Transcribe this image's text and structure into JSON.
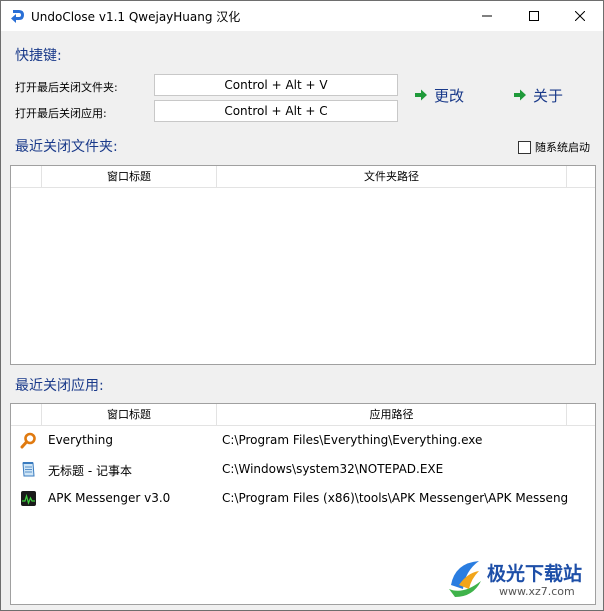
{
  "window": {
    "title": "UndoClose v1.1  QwejayHuang 汉化",
    "controls": {
      "minimize": "minimize",
      "maximize": "maximize",
      "close": "close"
    }
  },
  "hotkeys": {
    "section_title": "快捷键:",
    "folder_label": "打开最后关闭文件夹:",
    "folder_value": "Control + Alt + V",
    "app_label": "打开最后关闭应用:",
    "app_value": "Control + Alt + C",
    "change_label": "更改",
    "about_label": "关于"
  },
  "folders": {
    "section_title": "最近关闭文件夹:",
    "autostart_label": "随系统启动",
    "autostart_checked": false,
    "columns": [
      "窗口标题",
      "文件夹路径"
    ],
    "rows": []
  },
  "apps": {
    "section_title": "最近关闭应用:",
    "columns": [
      "窗口标题",
      "应用路径"
    ],
    "rows": [
      {
        "title": "Everything",
        "path": "C:\\Program Files\\Everything\\Everything.exe",
        "icon": "magnifier-icon"
      },
      {
        "title": "无标题 - 记事本",
        "path": "C:\\Windows\\system32\\NOTEPAD.EXE",
        "icon": "notepad-icon"
      },
      {
        "title": "APK Messenger v3.0",
        "path": "C:\\Program Files (x86)\\tools\\APK Messenger\\APK Messeng",
        "icon": "apk-messenger-icon"
      }
    ]
  },
  "watermark": {
    "name": "极光下载站",
    "url": "www.xz7.com"
  },
  "colors": {
    "accent": "#1a3a8a",
    "arrow": "#1f9a3a"
  }
}
